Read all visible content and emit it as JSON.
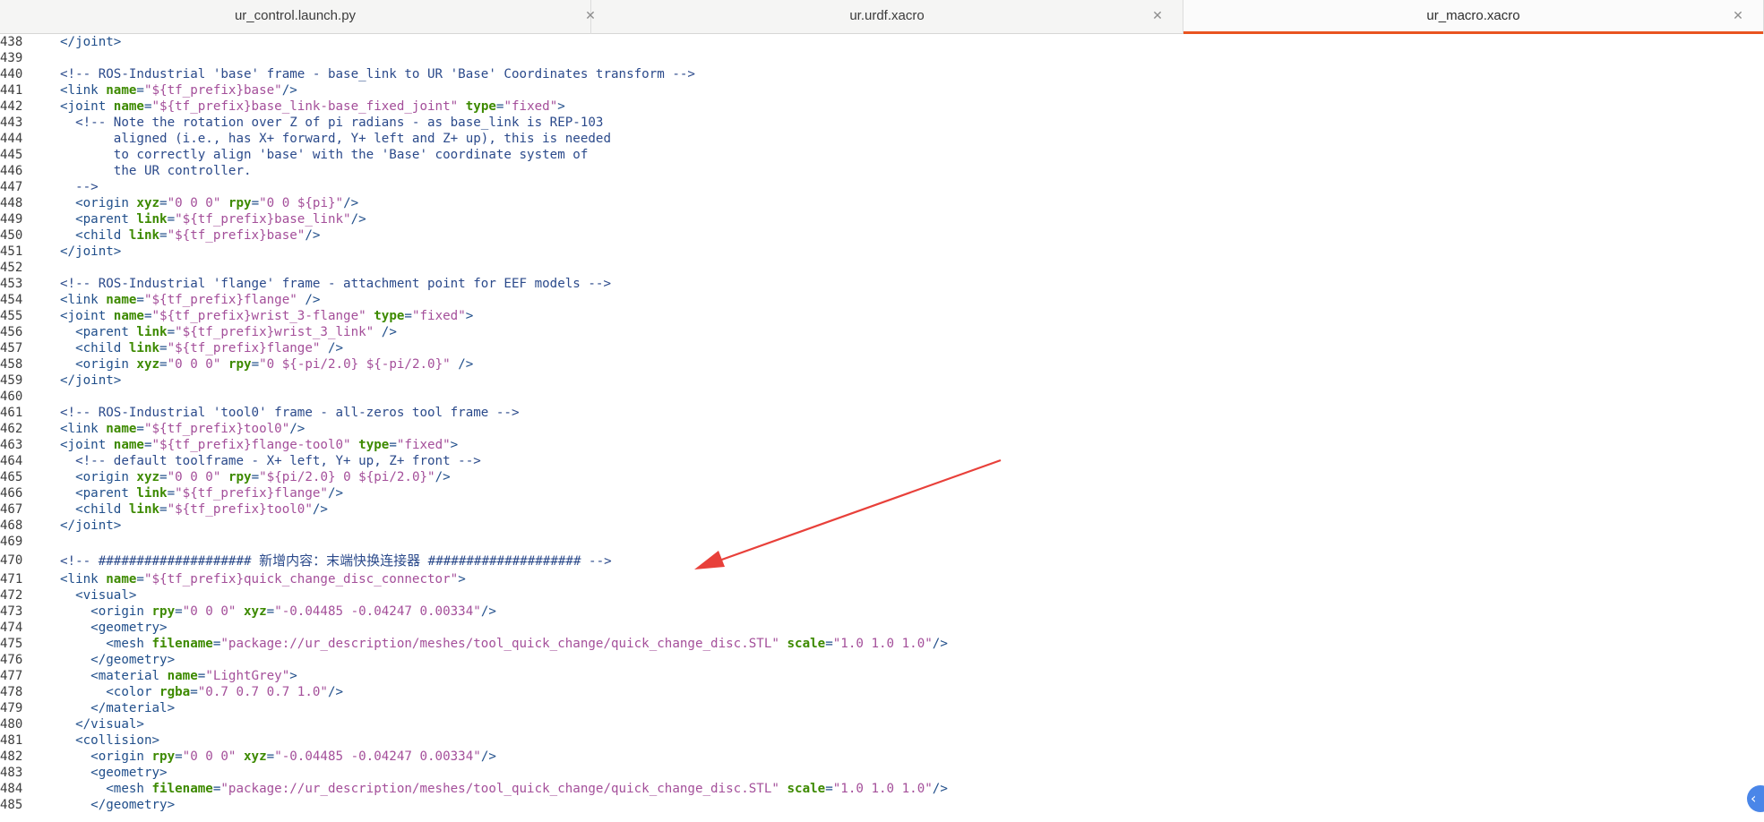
{
  "tabs": [
    {
      "label": "ur_control.launch.py",
      "active": false
    },
    {
      "label": "ur.urdf.xacro",
      "active": false
    },
    {
      "label": "ur_macro.xacro",
      "active": true
    }
  ],
  "colors": {
    "accent": "#e95420",
    "tag": "#214f8b",
    "attribute": "#3d8a00",
    "value": "#a44f9a",
    "comment": "#2b4a8b",
    "annotation_arrow": "#e8403a"
  },
  "icons": {
    "tab_close": "close-icon",
    "side_toggle": "chevron-left-icon"
  },
  "editor": {
    "lines": [
      {
        "num": "438",
        "tokens": [
          [
            "t",
            "</joint>"
          ]
        ]
      },
      {
        "num": "439",
        "tokens": []
      },
      {
        "num": "440",
        "tokens": [
          [
            "c",
            "<!-- ROS-Industrial 'base' frame - base_link to UR 'Base' Coordinates transform -->"
          ]
        ]
      },
      {
        "num": "441",
        "tokens": [
          [
            "t",
            "<link "
          ],
          [
            "a",
            "name"
          ],
          [
            "t",
            "="
          ],
          [
            "v",
            "\"${tf_prefix}base\""
          ],
          [
            "t",
            "/>"
          ]
        ]
      },
      {
        "num": "442",
        "tokens": [
          [
            "t",
            "<joint "
          ],
          [
            "a",
            "name"
          ],
          [
            "t",
            "="
          ],
          [
            "v",
            "\"${tf_prefix}base_link-base_fixed_joint\""
          ],
          [
            "t",
            " "
          ],
          [
            "a",
            "type"
          ],
          [
            "t",
            "="
          ],
          [
            "v",
            "\"fixed\""
          ],
          [
            "t",
            ">"
          ]
        ]
      },
      {
        "num": "443",
        "tokens": [
          [
            "t",
            "  "
          ],
          [
            "c",
            "<!-- Note the rotation over Z of pi radians - as base_link is REP-103"
          ]
        ]
      },
      {
        "num": "444",
        "tokens": [
          [
            "c",
            "       aligned (i.e., has X+ forward, Y+ left and Z+ up), this is needed"
          ]
        ]
      },
      {
        "num": "445",
        "tokens": [
          [
            "c",
            "       to correctly align 'base' with the 'Base' coordinate system of"
          ]
        ]
      },
      {
        "num": "446",
        "tokens": [
          [
            "c",
            "       the UR controller."
          ]
        ]
      },
      {
        "num": "447",
        "tokens": [
          [
            "c",
            "  -->"
          ]
        ]
      },
      {
        "num": "448",
        "tokens": [
          [
            "t",
            "  <origin "
          ],
          [
            "a",
            "xyz"
          ],
          [
            "t",
            "="
          ],
          [
            "v",
            "\"0 0 0\""
          ],
          [
            "t",
            " "
          ],
          [
            "a",
            "rpy"
          ],
          [
            "t",
            "="
          ],
          [
            "v",
            "\"0 0 ${pi}\""
          ],
          [
            "t",
            "/>"
          ]
        ]
      },
      {
        "num": "449",
        "tokens": [
          [
            "t",
            "  <parent "
          ],
          [
            "a",
            "link"
          ],
          [
            "t",
            "="
          ],
          [
            "v",
            "\"${tf_prefix}base_link\""
          ],
          [
            "t",
            "/>"
          ]
        ]
      },
      {
        "num": "450",
        "tokens": [
          [
            "t",
            "  <child "
          ],
          [
            "a",
            "link"
          ],
          [
            "t",
            "="
          ],
          [
            "v",
            "\"${tf_prefix}base\""
          ],
          [
            "t",
            "/>"
          ]
        ]
      },
      {
        "num": "451",
        "tokens": [
          [
            "t",
            "</joint>"
          ]
        ]
      },
      {
        "num": "452",
        "tokens": []
      },
      {
        "num": "453",
        "tokens": [
          [
            "c",
            "<!-- ROS-Industrial 'flange' frame - attachment point for EEF models -->"
          ]
        ]
      },
      {
        "num": "454",
        "tokens": [
          [
            "t",
            "<link "
          ],
          [
            "a",
            "name"
          ],
          [
            "t",
            "="
          ],
          [
            "v",
            "\"${tf_prefix}flange\""
          ],
          [
            "t",
            " />"
          ]
        ]
      },
      {
        "num": "455",
        "tokens": [
          [
            "t",
            "<joint "
          ],
          [
            "a",
            "name"
          ],
          [
            "t",
            "="
          ],
          [
            "v",
            "\"${tf_prefix}wrist_3-flange\""
          ],
          [
            "t",
            " "
          ],
          [
            "a",
            "type"
          ],
          [
            "t",
            "="
          ],
          [
            "v",
            "\"fixed\""
          ],
          [
            "t",
            ">"
          ]
        ]
      },
      {
        "num": "456",
        "tokens": [
          [
            "t",
            "  <parent "
          ],
          [
            "a",
            "link"
          ],
          [
            "t",
            "="
          ],
          [
            "v",
            "\"${tf_prefix}wrist_3_link\""
          ],
          [
            "t",
            " />"
          ]
        ]
      },
      {
        "num": "457",
        "tokens": [
          [
            "t",
            "  <child "
          ],
          [
            "a",
            "link"
          ],
          [
            "t",
            "="
          ],
          [
            "v",
            "\"${tf_prefix}flange\""
          ],
          [
            "t",
            " />"
          ]
        ]
      },
      {
        "num": "458",
        "tokens": [
          [
            "t",
            "  <origin "
          ],
          [
            "a",
            "xyz"
          ],
          [
            "t",
            "="
          ],
          [
            "v",
            "\"0 0 0\""
          ],
          [
            "t",
            " "
          ],
          [
            "a",
            "rpy"
          ],
          [
            "t",
            "="
          ],
          [
            "v",
            "\"0 ${-pi/2.0} ${-pi/2.0}\""
          ],
          [
            "t",
            " />"
          ]
        ]
      },
      {
        "num": "459",
        "tokens": [
          [
            "t",
            "</joint>"
          ]
        ]
      },
      {
        "num": "460",
        "tokens": []
      },
      {
        "num": "461",
        "tokens": [
          [
            "c",
            "<!-- ROS-Industrial 'tool0' frame - all-zeros tool frame -->"
          ]
        ]
      },
      {
        "num": "462",
        "tokens": [
          [
            "t",
            "<link "
          ],
          [
            "a",
            "name"
          ],
          [
            "t",
            "="
          ],
          [
            "v",
            "\"${tf_prefix}tool0\""
          ],
          [
            "t",
            "/>"
          ]
        ]
      },
      {
        "num": "463",
        "tokens": [
          [
            "t",
            "<joint "
          ],
          [
            "a",
            "name"
          ],
          [
            "t",
            "="
          ],
          [
            "v",
            "\"${tf_prefix}flange-tool0\""
          ],
          [
            "t",
            " "
          ],
          [
            "a",
            "type"
          ],
          [
            "t",
            "="
          ],
          [
            "v",
            "\"fixed\""
          ],
          [
            "t",
            ">"
          ]
        ]
      },
      {
        "num": "464",
        "tokens": [
          [
            "t",
            "  "
          ],
          [
            "c",
            "<!-- default toolframe - X+ left, Y+ up, Z+ front -->"
          ]
        ]
      },
      {
        "num": "465",
        "tokens": [
          [
            "t",
            "  <origin "
          ],
          [
            "a",
            "xyz"
          ],
          [
            "t",
            "="
          ],
          [
            "v",
            "\"0 0 0\""
          ],
          [
            "t",
            " "
          ],
          [
            "a",
            "rpy"
          ],
          [
            "t",
            "="
          ],
          [
            "v",
            "\"${pi/2.0} 0 ${pi/2.0}\""
          ],
          [
            "t",
            "/>"
          ]
        ]
      },
      {
        "num": "466",
        "tokens": [
          [
            "t",
            "  <parent "
          ],
          [
            "a",
            "link"
          ],
          [
            "t",
            "="
          ],
          [
            "v",
            "\"${tf_prefix}flange\""
          ],
          [
            "t",
            "/>"
          ]
        ]
      },
      {
        "num": "467",
        "tokens": [
          [
            "t",
            "  <child "
          ],
          [
            "a",
            "link"
          ],
          [
            "t",
            "="
          ],
          [
            "v",
            "\"${tf_prefix}tool0\""
          ],
          [
            "t",
            "/>"
          ]
        ]
      },
      {
        "num": "468",
        "tokens": [
          [
            "t",
            "</joint>"
          ]
        ]
      },
      {
        "num": "469",
        "tokens": []
      },
      {
        "num": "470",
        "tall": true,
        "tokens": [
          [
            "c",
            "<!-- #################### "
          ],
          [
            "z",
            "新增内容：末端快换连接器"
          ],
          [
            "c",
            " #################### -->"
          ]
        ]
      },
      {
        "num": "471",
        "tokens": [
          [
            "t",
            "<link "
          ],
          [
            "a",
            "name"
          ],
          [
            "t",
            "="
          ],
          [
            "v",
            "\"${tf_prefix}quick_change_disc_connector\""
          ],
          [
            "t",
            ">"
          ]
        ]
      },
      {
        "num": "472",
        "tokens": [
          [
            "t",
            "  <visual>"
          ]
        ]
      },
      {
        "num": "473",
        "tokens": [
          [
            "t",
            "    <origin "
          ],
          [
            "a",
            "rpy"
          ],
          [
            "t",
            "="
          ],
          [
            "v",
            "\"0 0 0\""
          ],
          [
            "t",
            " "
          ],
          [
            "a",
            "xyz"
          ],
          [
            "t",
            "="
          ],
          [
            "v",
            "\"-0.04485 -0.04247 0.00334\""
          ],
          [
            "t",
            "/>"
          ]
        ]
      },
      {
        "num": "474",
        "tokens": [
          [
            "t",
            "    <geometry>"
          ]
        ]
      },
      {
        "num": "475",
        "tokens": [
          [
            "t",
            "      <mesh "
          ],
          [
            "a",
            "filename"
          ],
          [
            "t",
            "="
          ],
          [
            "v",
            "\"package://ur_description/meshes/tool_quick_change/quick_change_disc.STL\""
          ],
          [
            "t",
            " "
          ],
          [
            "a",
            "scale"
          ],
          [
            "t",
            "="
          ],
          [
            "v",
            "\"1.0 1.0 1.0\""
          ],
          [
            "t",
            "/>"
          ]
        ]
      },
      {
        "num": "476",
        "tokens": [
          [
            "t",
            "    </geometry>"
          ]
        ]
      },
      {
        "num": "477",
        "tokens": [
          [
            "t",
            "    <material "
          ],
          [
            "a",
            "name"
          ],
          [
            "t",
            "="
          ],
          [
            "v",
            "\"LightGrey\""
          ],
          [
            "t",
            ">"
          ]
        ]
      },
      {
        "num": "478",
        "tokens": [
          [
            "t",
            "      <color "
          ],
          [
            "a",
            "rgba"
          ],
          [
            "t",
            "="
          ],
          [
            "v",
            "\"0.7 0.7 0.7 1.0\""
          ],
          [
            "t",
            "/>"
          ]
        ]
      },
      {
        "num": "479",
        "tokens": [
          [
            "t",
            "    </material>"
          ]
        ]
      },
      {
        "num": "480",
        "tokens": [
          [
            "t",
            "  </visual>"
          ]
        ]
      },
      {
        "num": "481",
        "tokens": [
          [
            "t",
            "  <collision>"
          ]
        ]
      },
      {
        "num": "482",
        "tokens": [
          [
            "t",
            "    <origin "
          ],
          [
            "a",
            "rpy"
          ],
          [
            "t",
            "="
          ],
          [
            "v",
            "\"0 0 0\""
          ],
          [
            "t",
            " "
          ],
          [
            "a",
            "xyz"
          ],
          [
            "t",
            "="
          ],
          [
            "v",
            "\"-0.04485 -0.04247 0.00334\""
          ],
          [
            "t",
            "/>"
          ]
        ]
      },
      {
        "num": "483",
        "tokens": [
          [
            "t",
            "    <geometry>"
          ]
        ]
      },
      {
        "num": "484",
        "tokens": [
          [
            "t",
            "      <mesh "
          ],
          [
            "a",
            "filename"
          ],
          [
            "t",
            "="
          ],
          [
            "v",
            "\"package://ur_description/meshes/tool_quick_change/quick_change_disc.STL\""
          ],
          [
            "t",
            " "
          ],
          [
            "a",
            "scale"
          ],
          [
            "t",
            "="
          ],
          [
            "v",
            "\"1.0 1.0 1.0\""
          ],
          [
            "t",
            "/>"
          ]
        ]
      },
      {
        "num": "485",
        "tokens": [
          [
            "t",
            "    </geometry>"
          ]
        ]
      }
    ]
  }
}
